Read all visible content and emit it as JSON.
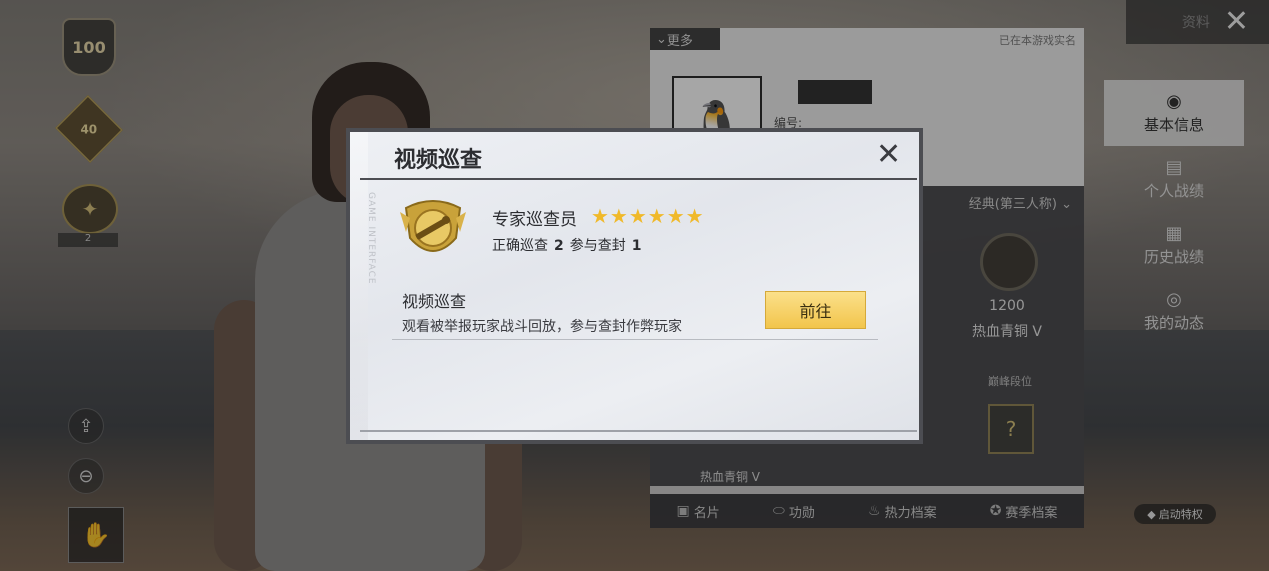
{
  "left_badges": {
    "level_value": "100",
    "season_value": "40",
    "gun_badge_count": "2"
  },
  "topbar": {
    "data_label": "资料",
    "close_glyph": "✕"
  },
  "profile": {
    "more_label": "更多",
    "realname_note": "已在本游戏实名",
    "id_label": "编号:",
    "mode_label": "经典(第三人称)",
    "rank_score": "1200",
    "rank_name": "热血青铜 V",
    "peak_label": "巅峰段位",
    "left_rank_name": "热血青铜 V",
    "tabs": [
      {
        "label": "名片"
      },
      {
        "label": "功勋"
      },
      {
        "label": "热力档案"
      },
      {
        "label": "赛季档案"
      }
    ]
  },
  "sidenav": {
    "items": [
      {
        "label": "基本信息"
      },
      {
        "label": "个人战绩"
      },
      {
        "label": "历史战绩"
      },
      {
        "label": "我的动态"
      }
    ],
    "privilege_label": "启动特权"
  },
  "modal": {
    "title": "视频巡查",
    "side_text": "GAME INTERFACE",
    "role_title": "专家巡查员",
    "stars": "★★★★★★",
    "star_count": 6,
    "correct_label": "正确巡查",
    "correct_value": "2",
    "ban_label": "参与查封",
    "ban_value": "1",
    "section_title": "视频巡查",
    "section_desc": "观看被举报玩家战斗回放，参与查封作弊玩家",
    "go_button": "前往",
    "close_glyph": "✕"
  },
  "colors": {
    "accent_gold": "#f2c54c",
    "star_gold": "#f0b92a",
    "modal_bg": "#e3e6ec",
    "modal_frame": "#4c4d52"
  }
}
